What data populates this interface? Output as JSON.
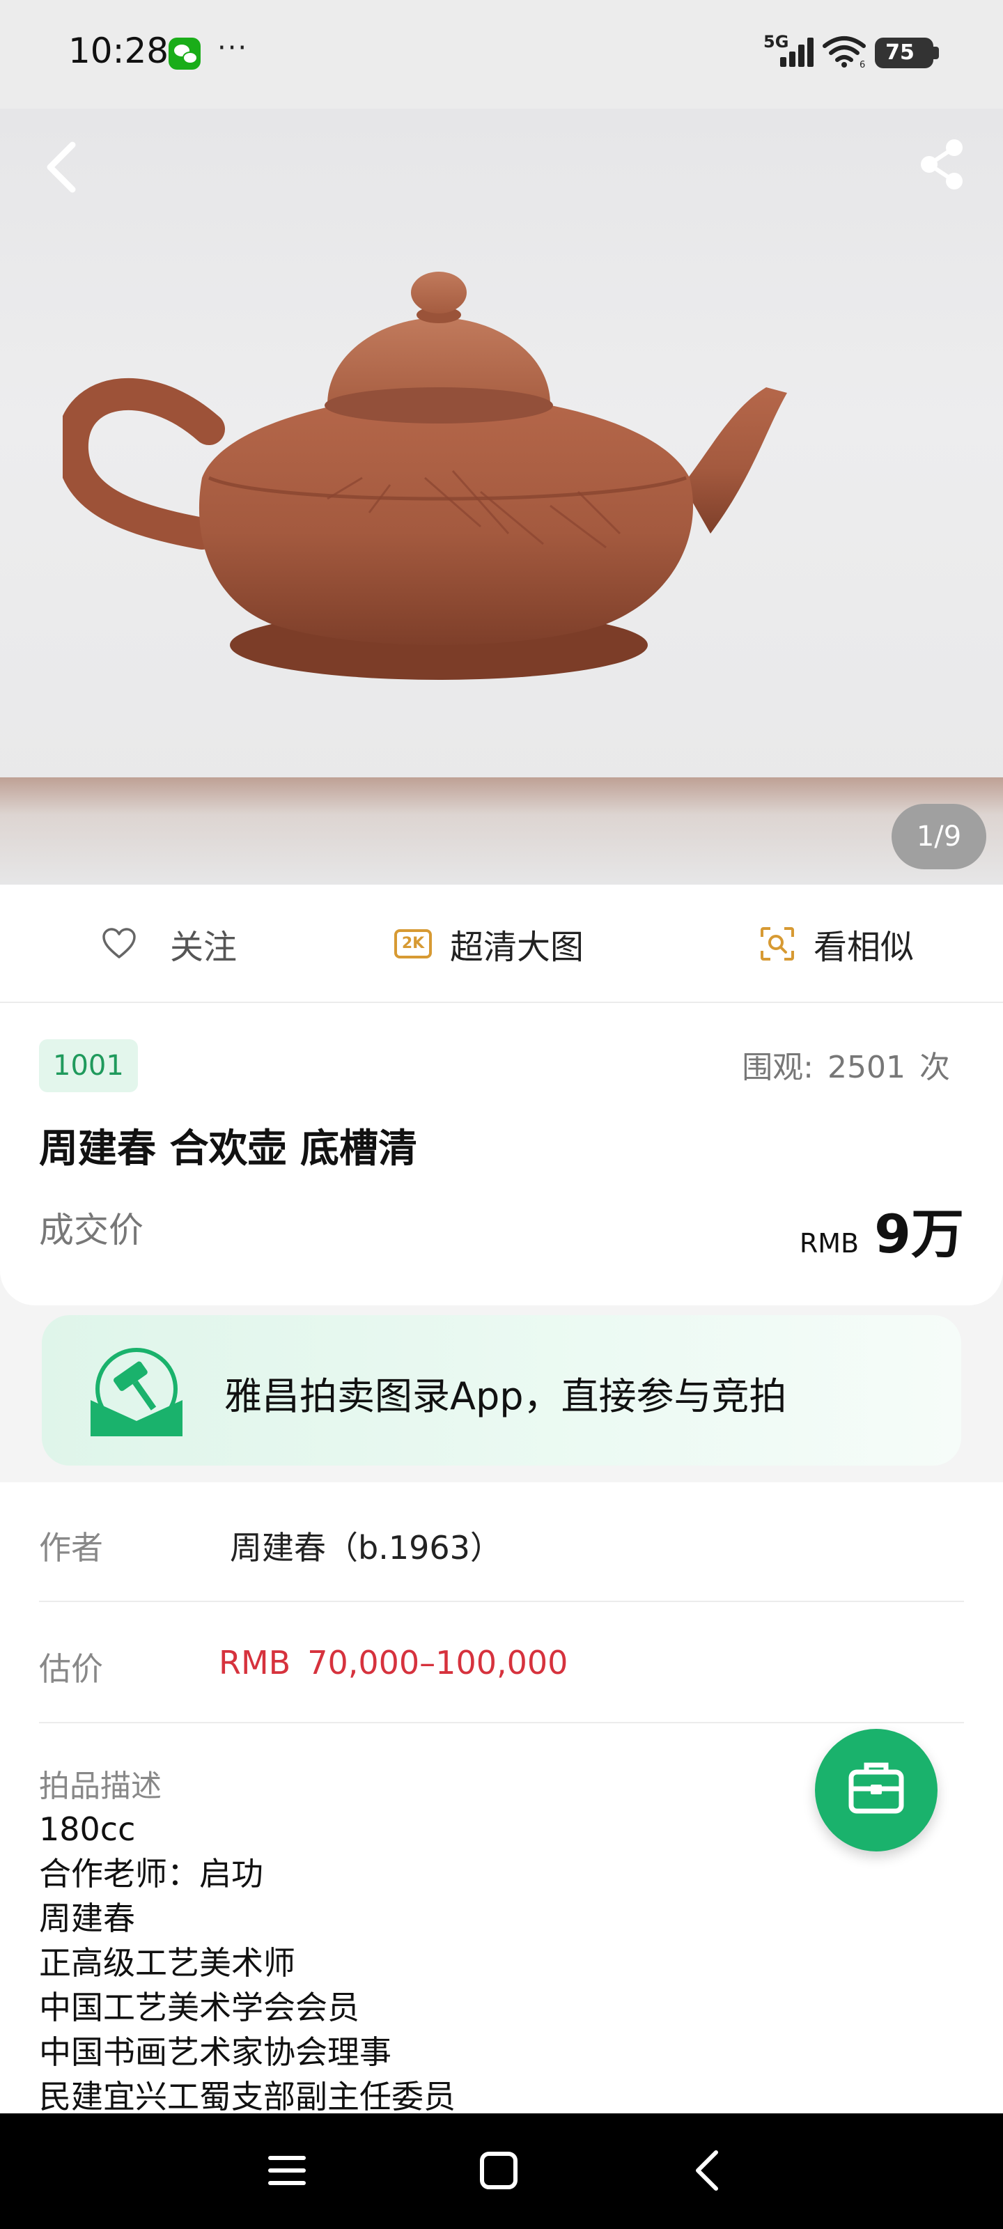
{
  "status_bar": {
    "time": "10:28",
    "more": "···",
    "network": "5G",
    "wifi_badge": "6",
    "battery": "75"
  },
  "gallery": {
    "counter": "1/9",
    "back_icon": "chevron-left-icon",
    "share_icon": "share-icon"
  },
  "actions": {
    "follow": "关注",
    "hd": "超清大图",
    "hd_badge": "2K",
    "similar": "看相似"
  },
  "lot": {
    "number": "1001",
    "views_label": "围观:",
    "views_count": "2501",
    "views_unit": "次",
    "title": "周建春 合欢壶 底槽清",
    "deal_label": "成交价",
    "deal_currency": "RMB",
    "deal_amount": "9万"
  },
  "promo": {
    "text": "雅昌拍卖图录App，直接参与竞拍"
  },
  "details": {
    "author_label": "作者",
    "author_value": "周建春（b.1963）",
    "estimate_label": "估价",
    "estimate_currency": "RMB",
    "estimate_value": "70,000–100,000",
    "description_label": "拍品描述",
    "description_lines": [
      "180cc",
      "合作老师：启功",
      "周建春",
      "正高级工艺美术师",
      "中国工艺美术学会会员",
      "中国书画艺术家协会理事",
      "民建宜兴工蜀支部副主任委员"
    ]
  },
  "colors": {
    "accent_green": "#1ab26c",
    "price_red": "#d6323d",
    "hd_orange": "#d79a33"
  }
}
